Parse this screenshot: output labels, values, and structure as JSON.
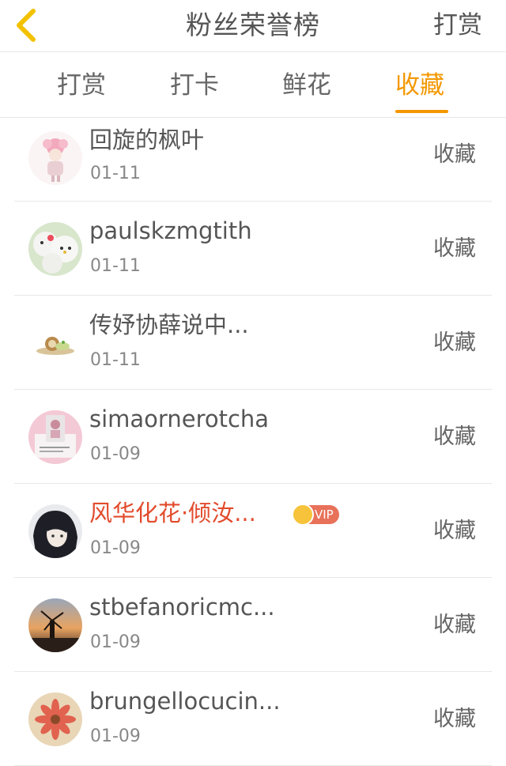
{
  "header": {
    "title": "粉丝荣誉榜",
    "action_label": "打赏"
  },
  "tabs": [
    {
      "label": "打赏"
    },
    {
      "label": "打卡"
    },
    {
      "label": "鲜花"
    },
    {
      "label": "收藏"
    }
  ],
  "active_tab": "收藏",
  "colors": {
    "accent": "#f39800",
    "vip_name": "#e24b2c",
    "vip_badge": "#e8715a"
  },
  "items": [
    {
      "name": "回旋的枫叶",
      "date": "01-11",
      "action": "收藏"
    },
    {
      "name": "paulskzmgtith",
      "date": "01-11",
      "action": "收藏"
    },
    {
      "name": "传妤协薛说中...",
      "date": "01-11",
      "action": "收藏"
    },
    {
      "name": "simaornerotcha",
      "date": "01-09",
      "action": "收藏"
    },
    {
      "name": "风华化花·倾汝...",
      "date": "01-09",
      "action": "收藏",
      "badge": "VIP"
    },
    {
      "name": "stbefanoricmc...",
      "date": "01-09",
      "action": "收藏"
    },
    {
      "name": "brungellocucin...",
      "date": "01-09",
      "action": "收藏"
    }
  ]
}
